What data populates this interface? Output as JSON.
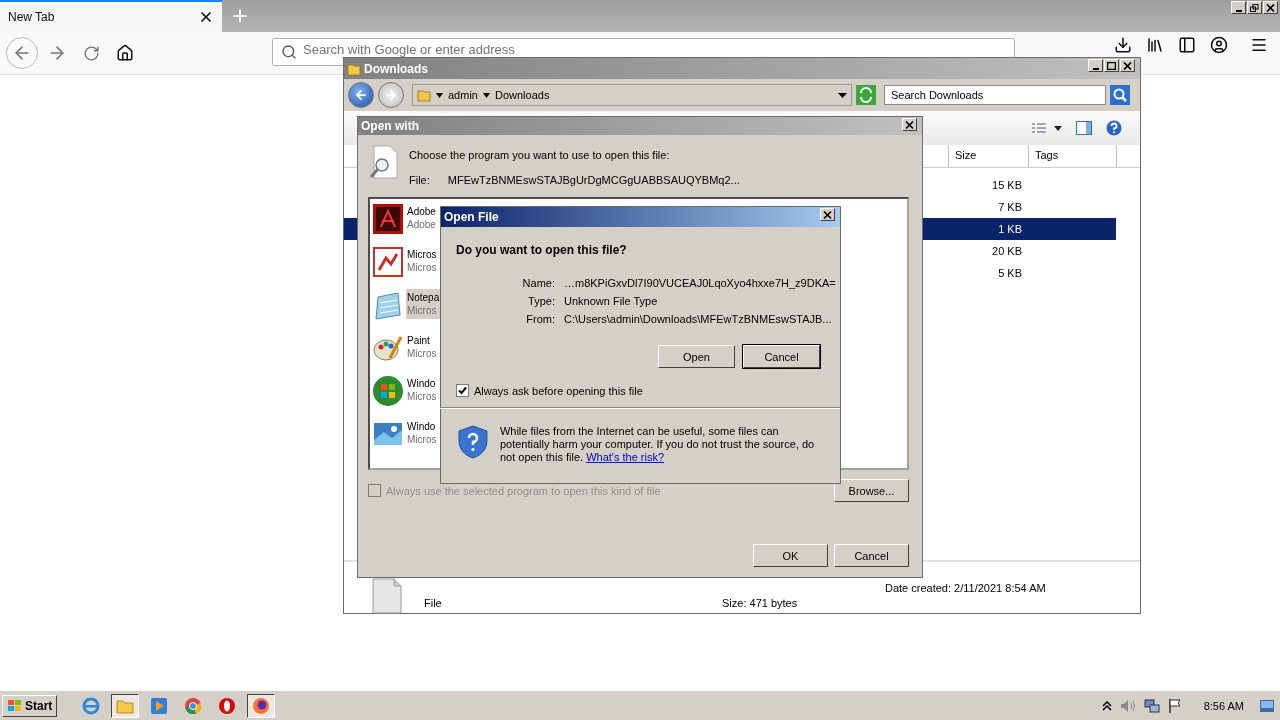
{
  "browser": {
    "tabs": [
      {
        "title": "New Tab",
        "selected": true
      }
    ],
    "address": {
      "placeholder": "Search with Google or enter address"
    }
  },
  "explorer": {
    "title": "Downloads",
    "breadcrumb": [
      "admin",
      "Downloads"
    ],
    "search": {
      "placeholder": "Search Downloads"
    },
    "columns": [
      "Size",
      "Tags"
    ],
    "rows": [
      {
        "size": "15 KB",
        "selected": false
      },
      {
        "size": "7 KB",
        "selected": false
      },
      {
        "size": "1 KB",
        "selected": true
      },
      {
        "size": "20 KB",
        "selected": false
      },
      {
        "size": "5 KB",
        "selected": false
      }
    ],
    "details": {
      "date_created": "Date created: 2/11/2021 8:54 AM",
      "type": "File",
      "size": "Size: 471 bytes"
    }
  },
  "open_with": {
    "title": "Open with",
    "prompt": "Choose the program you want to use to open this file:",
    "file_label": "File:",
    "file_name": "MFEwTzBNMEswSTAJBgUrDgMCGgUABBSAUQYBMq2...",
    "programs": [
      {
        "kind": "pdf",
        "name": "Adobe",
        "publisher": "Adobe",
        "selected": false
      },
      {
        "kind": "presentation",
        "name": "Micros",
        "publisher": "Micros",
        "selected": false
      },
      {
        "kind": "notepad",
        "name": "Notepa",
        "publisher": "Micros",
        "selected": true
      },
      {
        "kind": "paint",
        "name": "Paint",
        "publisher": "Micros",
        "selected": false
      },
      {
        "kind": "windows",
        "name": "Windo",
        "publisher": "Micros",
        "selected": false
      },
      {
        "kind": "photo",
        "name": "Windo",
        "publisher": "Micros",
        "selected": false
      }
    ],
    "always_use": {
      "label": "Always use the selected program to open this kind of file",
      "checked": false,
      "disabled": true
    },
    "browse": "Browse...",
    "ok": "OK",
    "cancel": "Cancel"
  },
  "open_file": {
    "title": "Open File",
    "question": "Do you want to open this file?",
    "fields": [
      {
        "label": "Name:",
        "value": "…m8KPiGxvDl7I90VUCEAJ0LqoXyo4hxxe7H_z9DKA="
      },
      {
        "label": "Type:",
        "value": "Unknown File Type"
      },
      {
        "label": "From:",
        "value": "C:\\Users\\admin\\Downloads\\MFEwTzBNMEswSTAJB..."
      }
    ],
    "open": "Open",
    "cancel": "Cancel",
    "always_ask": {
      "label": "Always ask before opening this file",
      "checked": true
    },
    "warning": "While files from the Internet can be useful, some files can potentially harm your computer. If you do not trust the source, do not open this file.",
    "risk_link": "What's the risk?"
  },
  "taskbar": {
    "start": "Start",
    "apps": [
      {
        "kind": "ie",
        "selected": false
      },
      {
        "kind": "explorer",
        "selected": true
      },
      {
        "kind": "media",
        "selected": false
      },
      {
        "kind": "chrome",
        "selected": false
      },
      {
        "kind": "opera",
        "selected": false
      },
      {
        "kind": "firefox",
        "selected": true
      }
    ],
    "clock": "8:56 AM"
  }
}
